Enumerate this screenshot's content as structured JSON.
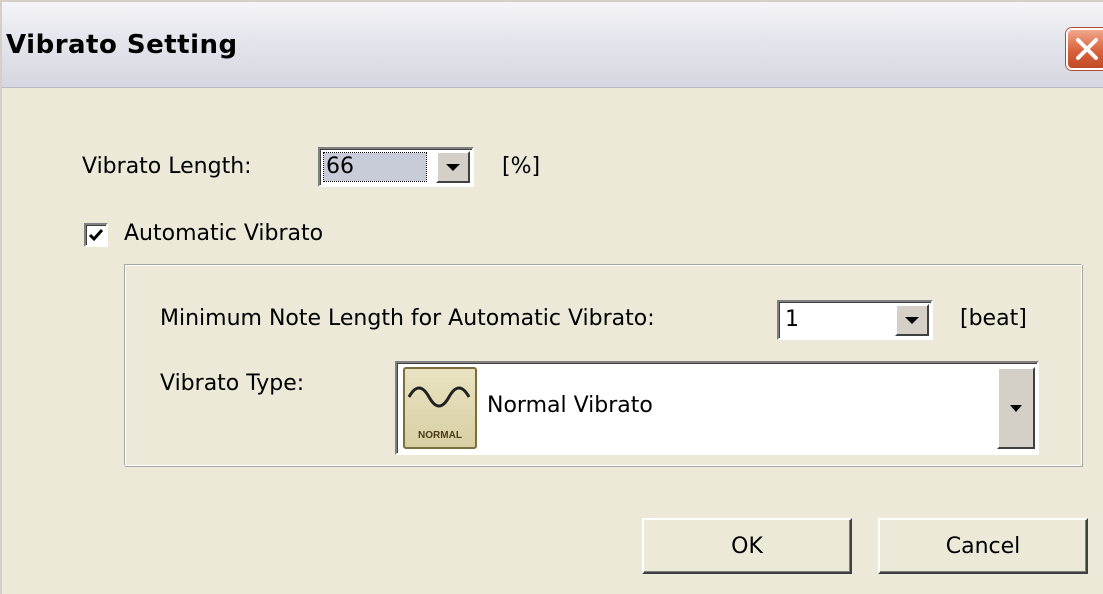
{
  "window": {
    "title": "Vibrato Setting"
  },
  "vibrato_length": {
    "label": "Vibrato Length:",
    "value": "66",
    "unit": "[%]"
  },
  "automatic_vibrato": {
    "label": "Automatic Vibrato",
    "checked": true
  },
  "min_note_length": {
    "label": "Minimum Note Length for Automatic Vibrato:",
    "value": "1",
    "unit": "[beat]"
  },
  "vibrato_type": {
    "label": "Vibrato Type:",
    "icon_text": "NORMAL",
    "value": "Normal Vibrato"
  },
  "buttons": {
    "ok": "OK",
    "cancel": "Cancel"
  },
  "icons": {
    "close": "close-icon",
    "checkmark": "checkmark-icon",
    "dropdown": "chevron-down-icon",
    "vibrato_type": "normal-vibrato-icon"
  }
}
